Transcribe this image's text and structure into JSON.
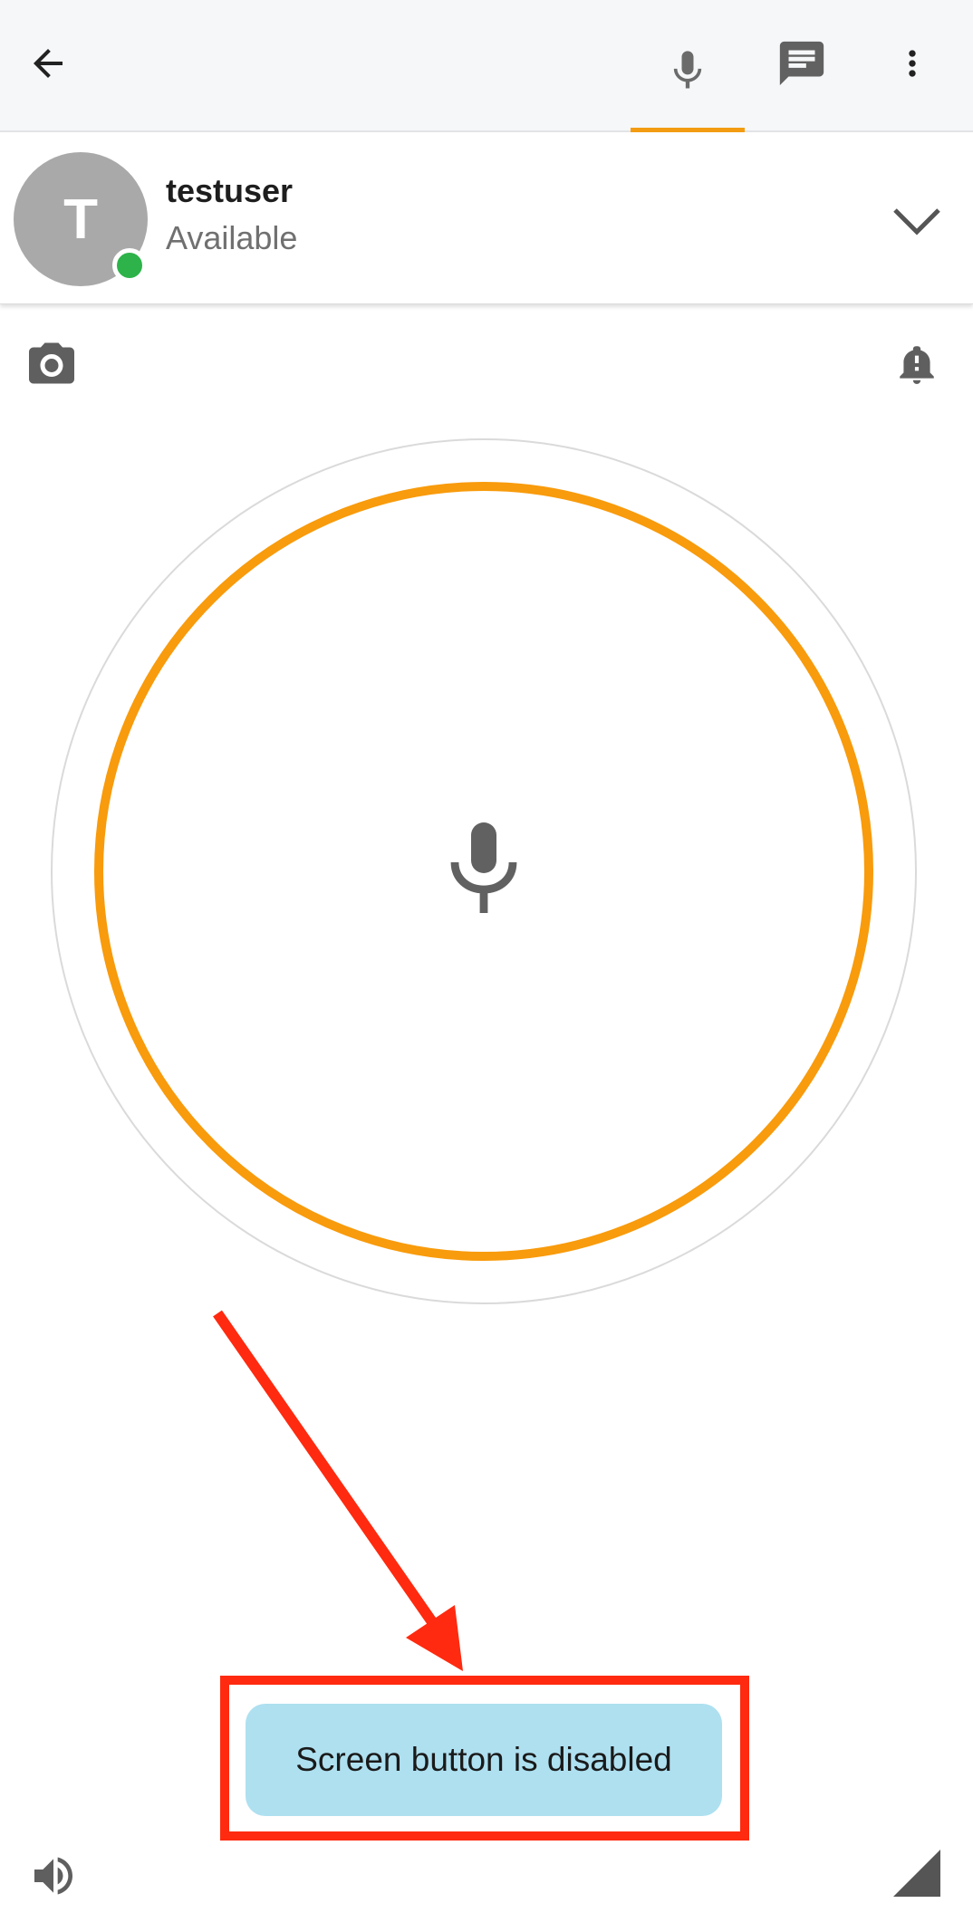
{
  "toolbar": {
    "icons": [
      "back-arrow-icon",
      "microphone-icon",
      "chat-icon",
      "more-vert-icon"
    ],
    "active_tab": "voice",
    "accent_color": "#f39c12"
  },
  "contact": {
    "avatar_initial": "T",
    "name": "testuser",
    "status": "Available",
    "presence_color": "#2db34a"
  },
  "ptt": {
    "ring_color": "#f89b0c",
    "icon": "microphone-icon"
  },
  "toast": {
    "message": "Screen button is disabled",
    "background": "#aee0f0"
  },
  "annotation": {
    "color": "#ff2a0f"
  }
}
